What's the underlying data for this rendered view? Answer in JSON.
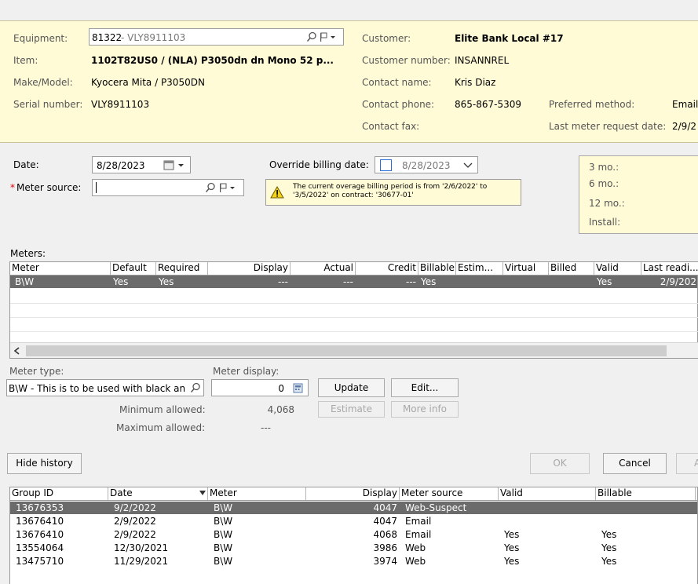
{
  "info": {
    "equipment_label": "Equipment:",
    "equipment_id": "81322",
    "equipment_suffix": " - VLY8911103",
    "item_label": "Item:",
    "item_value": "1102T82US0 / (NLA) P3050dn dn Mono 52 p...",
    "make_label": "Make/Model:",
    "make_value": "Kyocera Mita / P3050DN",
    "serial_label": "Serial number:",
    "serial_value": "VLY8911103",
    "customer_label": "Customer:",
    "customer_value": "Elite Bank Local #17",
    "custnum_label": "Customer number:",
    "custnum_value": "INSANNREL",
    "contact_label": "Contact name:",
    "contact_value": "Kris Diaz",
    "phone_label": "Contact phone:",
    "phone_value": "865-867-5309",
    "fax_label": "Contact fax:",
    "fax_value": "",
    "pref_label": "Preferred method:",
    "pref_value": "Email",
    "last_req_label": "Last meter request date:",
    "last_req_value": "2/9/2"
  },
  "form": {
    "date_label": "Date:",
    "date_value": "8/28/2023",
    "source_required_mark": "*",
    "source_label": "Meter source:",
    "source_value": "",
    "override_label": "Override billing date:",
    "override_value": "8/28/2023",
    "warning_text": "The current overage billing period is from '2/6/2022' to '3/5/2022' on contract: '30677-01'",
    "summary": {
      "m3": "3 mo.:",
      "m6": "6 mo.:",
      "m12": "12 mo.:",
      "install": "Install:"
    }
  },
  "meters": {
    "title": "Meters:",
    "columns": [
      "Meter",
      "Default",
      "Required",
      "Display",
      "Actual",
      "Credit",
      "Billable",
      "Estim...",
      "Virtual",
      "Billed",
      "Valid",
      "Last readi..."
    ],
    "rows": [
      [
        "B\\W",
        "Yes",
        "Yes",
        "---",
        "---",
        "---",
        "Yes",
        "",
        "",
        "",
        "Yes",
        "2/9/202"
      ]
    ]
  },
  "entry": {
    "type_label": "Meter type:",
    "type_value": "B\\W - This is to be used with black an",
    "display_label": "Meter display:",
    "display_value": "0",
    "update_label": "Update",
    "edit_label": "Edit...",
    "estimate_label": "Estimate",
    "moreinfo_label": "More info",
    "min_label": "Minimum allowed:",
    "min_value": "4,068",
    "max_label": "Maximum allowed:",
    "max_value": "---"
  },
  "actions": {
    "hide_history": "Hide history",
    "ok": "OK",
    "cancel": "Cancel",
    "apply": "A"
  },
  "history": {
    "columns": [
      "Group ID",
      "Date",
      "Meter",
      "Display",
      "Meter source",
      "Valid",
      "Billable"
    ],
    "rows": [
      [
        "13676353",
        "9/2/2022",
        "B\\W",
        "4047",
        "Web-Suspect",
        "",
        ""
      ],
      [
        "13676410",
        "2/9/2022",
        "B\\W",
        "4047",
        "Email",
        "",
        ""
      ],
      [
        "13676410",
        "2/9/2022",
        "B\\W",
        "4068",
        "Email",
        "Yes",
        "Yes"
      ],
      [
        "13554064",
        "12/30/2021",
        "B\\W",
        "3986",
        "Web",
        "Yes",
        "Yes"
      ],
      [
        "13475710",
        "11/29/2021",
        "B\\W",
        "3974",
        "Web",
        "Yes",
        "Yes"
      ]
    ]
  }
}
